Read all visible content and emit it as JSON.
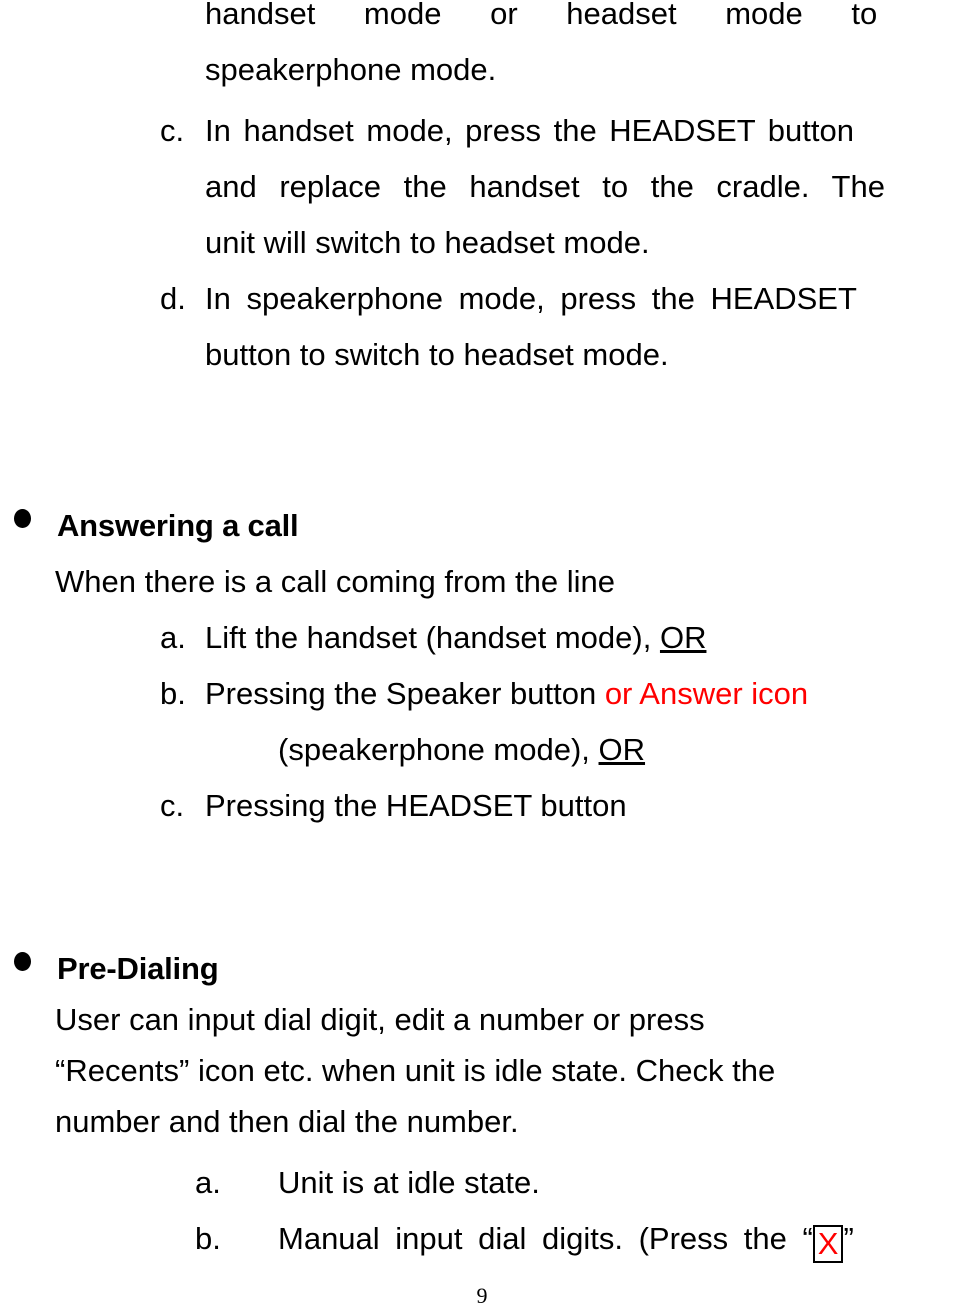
{
  "document": {
    "page_number": "9"
  },
  "blocks": {
    "continued_item_b": {
      "line1": "handset mode or headset mode to",
      "line2": "speakerphone mode."
    },
    "item_c_switch": {
      "marker": "c.",
      "line1": "In handset mode, press the HEADSET button",
      "line2": "and replace the handset to the cradle. The",
      "line3": "unit will switch to headset mode."
    },
    "item_d_switch": {
      "marker": "d.",
      "line1": "In speakerphone mode, press the HEADSET",
      "line2": "button to switch to headset mode."
    },
    "answering_section": {
      "heading": "Answering a call",
      "intro": "When there is a call coming from the line",
      "item_a": {
        "marker": "a.",
        "text_before": "Lift the handset (handset mode), ",
        "text_or": "OR"
      },
      "item_b": {
        "marker": "b.",
        "text_before": "Pressing the Speaker button ",
        "text_red": "or Answer icon",
        "line2_before": "(speakerphone mode), ",
        "line2_or": "OR"
      },
      "item_c": {
        "marker": "c.",
        "text": "Pressing the HEADSET button"
      }
    },
    "predialing_section": {
      "heading": "Pre-Dialing",
      "body_line1": "User can input dial digit, edit a number or press",
      "body_line2": "“Recents” icon etc. when unit is idle state. Check the",
      "body_line3": "number and then dial the number.",
      "item_a": {
        "marker": "a.",
        "text": "Unit is at idle state."
      },
      "item_b": {
        "marker": "b.",
        "text_before": "Manual input dial digits. (Press the “",
        "boxed_char": "X",
        "text_after": "”"
      }
    }
  },
  "colors": {
    "text": "#000000",
    "accent_red": "#ff0000",
    "background": "#ffffff"
  }
}
